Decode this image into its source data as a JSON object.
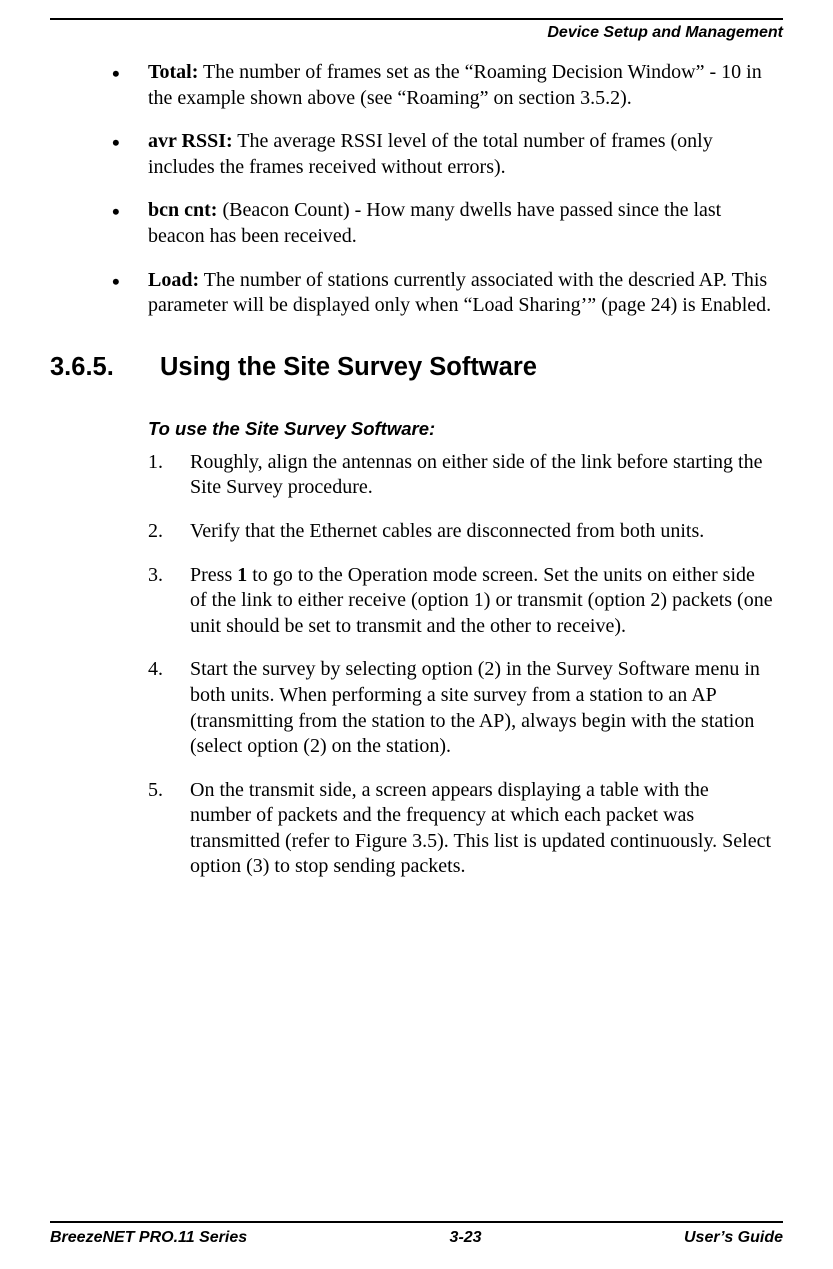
{
  "header": {
    "section_title": "Device Setup and Management"
  },
  "bullets": [
    {
      "term": "Total:",
      "text": " The number of frames set as the “Roaming Decision Window” - 10 in the example shown above (see “Roaming” on section 3.5.2)."
    },
    {
      "term": "avr RSSI:",
      "text": " The average RSSI level of the total number of frames (only includes the frames received without errors)."
    },
    {
      "term": "bcn cnt:",
      "text": " (Beacon Count) - How many dwells have passed since the last beacon has been received."
    },
    {
      "term": "Load:",
      "text": " The number of stations currently associated with the descried AP. This parameter will be displayed only when “Load Sharing’” (page 24) is Enabled."
    }
  ],
  "section": {
    "number": "3.6.5.",
    "title": "Using the Site Survey Software"
  },
  "instruction": {
    "heading": "To use the Site Survey Software:",
    "steps": [
      {
        "pre": "Roughly, align the antennas on either side of the link before starting the Site Survey procedure."
      },
      {
        "pre": "Verify that the Ethernet cables are disconnected from both units."
      },
      {
        "pre": "Press ",
        "bold": "1",
        "post": " to go to the Operation mode screen. Set the units on either side of the link to either receive (option 1) or transmit (option 2) packets (one unit should be set to transmit and the other to receive)."
      },
      {
        "pre": "Start the survey by selecting option (2) in the Survey Software menu in both units. When performing a site survey from a station to an AP (transmitting from the station to the AP), always begin with the station (select option (2) on the station)."
      },
      {
        "pre": "On the transmit side, a screen appears displaying a table with the number of packets and the frequency at which each packet was transmitted (refer to Figure 3.5). This list is updated continuously. Select option (3) to stop sending packets."
      }
    ]
  },
  "footer": {
    "left": "BreezeNET PRO.11 Series",
    "center": "3-23",
    "right": "User’s Guide"
  }
}
